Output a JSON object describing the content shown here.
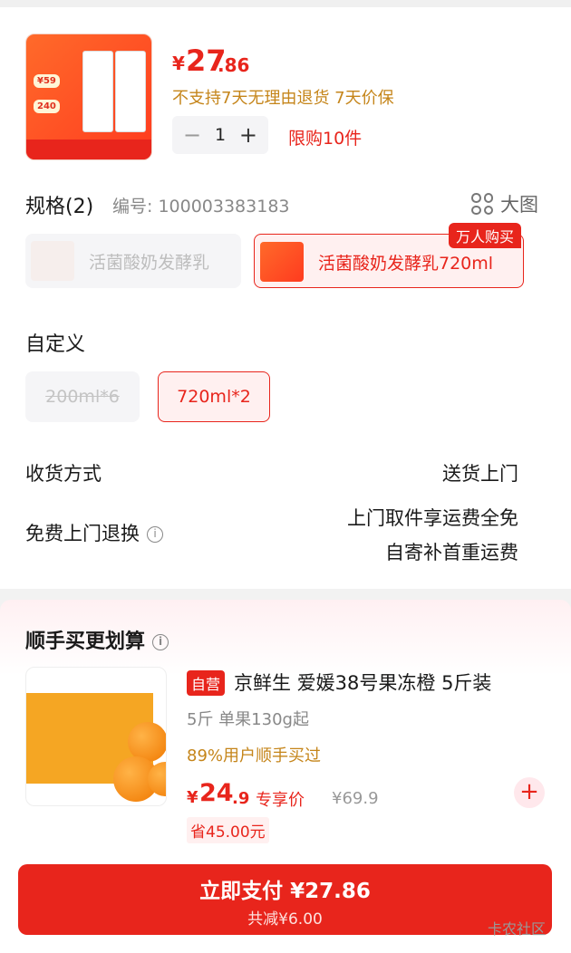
{
  "product": {
    "price_symbol": "¥",
    "price_int": "27",
    "price_dec": ".86",
    "return_policy": "不支持7天无理由退货  7天价保",
    "quantity": "1",
    "limit": "限购10件"
  },
  "spec": {
    "title": "规格(2)",
    "code": "编号: 100003383183",
    "big_image": "大图",
    "options": [
      "活菌酸奶发酵乳",
      "活菌酸奶发酵乳720ml"
    ],
    "hot_badge": "万人购买"
  },
  "custom": {
    "title": "自定义",
    "options": [
      "200ml*6",
      "720ml*2"
    ]
  },
  "delivery": {
    "label": "收货方式",
    "value": "送货上门"
  },
  "free_return": {
    "label": "免费上门退换",
    "value_line1": "上门取件享运费全免",
    "value_line2": "自寄补首重运费"
  },
  "recommend": {
    "title": "顺手买更划算",
    "badge": "自营",
    "name": "京鲜生 爱媛38号果冻橙 5斤装",
    "spec": "5斤 单果130g起",
    "bought": "89%用户顺手买过",
    "price_symbol": "¥",
    "price_int": "24",
    "price_dec": ".9",
    "exclusive": "专享价",
    "original": "¥69.9",
    "save": "省45.00元"
  },
  "pay": {
    "main": "立即支付 ¥27.86",
    "sub": "共减¥6.00"
  },
  "watermark": "卡农社区",
  "colors": {
    "accent": "#e8251c",
    "gold": "#c5851a"
  }
}
